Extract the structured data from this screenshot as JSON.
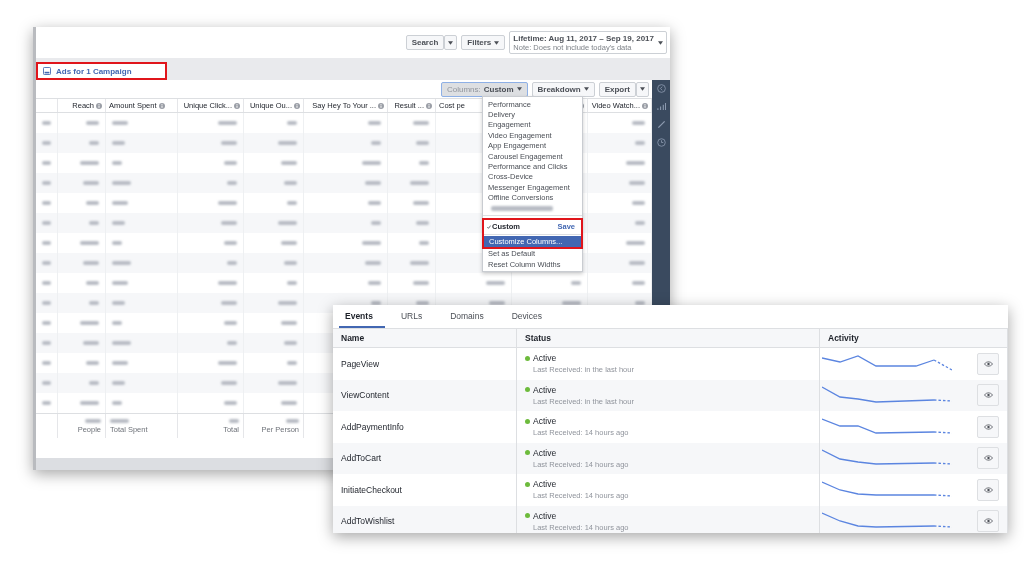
{
  "campaign_view": {
    "toolbar": {
      "search_button": "Search",
      "filters_button": "Filters",
      "date_range": {
        "label": "Lifetime: Aug 11, 2017 – Sep 19, 2017",
        "note": "Note: Does not include today's data"
      }
    },
    "tabs": [
      {
        "label": "Ads for 1 Campaign",
        "selected": true,
        "annotated": true
      }
    ],
    "actions": {
      "columns_button": {
        "prefix": "Columns:",
        "value": "Custom",
        "open": true
      },
      "breakdown_button": "Breakdown",
      "export_button": "Export"
    },
    "table": {
      "columns": [
        {
          "info": false
        },
        {
          "label": "Reach",
          "info": true,
          "footer": "People"
        },
        {
          "label": "Amount Spent",
          "info": true,
          "footer": "Total Spent"
        },
        {
          "label": "Unique Click...",
          "info": true,
          "footer": "Total"
        },
        {
          "label": "Unique Ou...",
          "info": true,
          "footer": "Per Person"
        },
        {
          "label": "Say Hey To Your ...",
          "info": true
        },
        {
          "label": "Result ...",
          "info": true
        },
        {
          "label": "Cost pe",
          "info": false
        },
        {
          "info": true
        },
        {
          "label": "Video Watch...",
          "info": true
        }
      ]
    },
    "columns_menu": {
      "presets": [
        "Performance",
        "Delivery",
        "Engagement",
        "Video Engagement",
        "App Engagement",
        "Carousel Engagement",
        "Performance and Clicks",
        "Cross-Device",
        "Messenger Engagement",
        "Offline Conversions"
      ],
      "custom": {
        "label": "Custom",
        "checked": true,
        "save": "Save",
        "annotated": true
      },
      "actions": [
        {
          "label": "Customize Columns...",
          "selected": true
        },
        {
          "label": "Set as Default",
          "selected": false
        },
        {
          "label": "Reset Column Widths",
          "selected": false
        }
      ]
    }
  },
  "events_panel": {
    "tabs": [
      {
        "label": "Events",
        "selected": true
      },
      {
        "label": "URLs",
        "selected": false
      },
      {
        "label": "Domains",
        "selected": false
      },
      {
        "label": "Devices",
        "selected": false
      }
    ],
    "columns": [
      "Name",
      "Status",
      "Activity"
    ],
    "rows": [
      {
        "name": "PageView",
        "status": "Active",
        "last_received": "Last Received: in the last hour"
      },
      {
        "name": "ViewContent",
        "status": "Active",
        "last_received": "Last Received: in the last hour"
      },
      {
        "name": "AddPaymentInfo",
        "status": "Active",
        "last_received": "Last Received: 14 hours ago"
      },
      {
        "name": "AddToCart",
        "status": "Active",
        "last_received": "Last Received: 14 hours ago"
      },
      {
        "name": "InitiateCheckout",
        "status": "Active",
        "last_received": "Last Received: 14 hours ago"
      },
      {
        "name": "AddToWishlist",
        "status": "Active",
        "last_received": "Last Received: 14 hours ago"
      }
    ]
  }
}
